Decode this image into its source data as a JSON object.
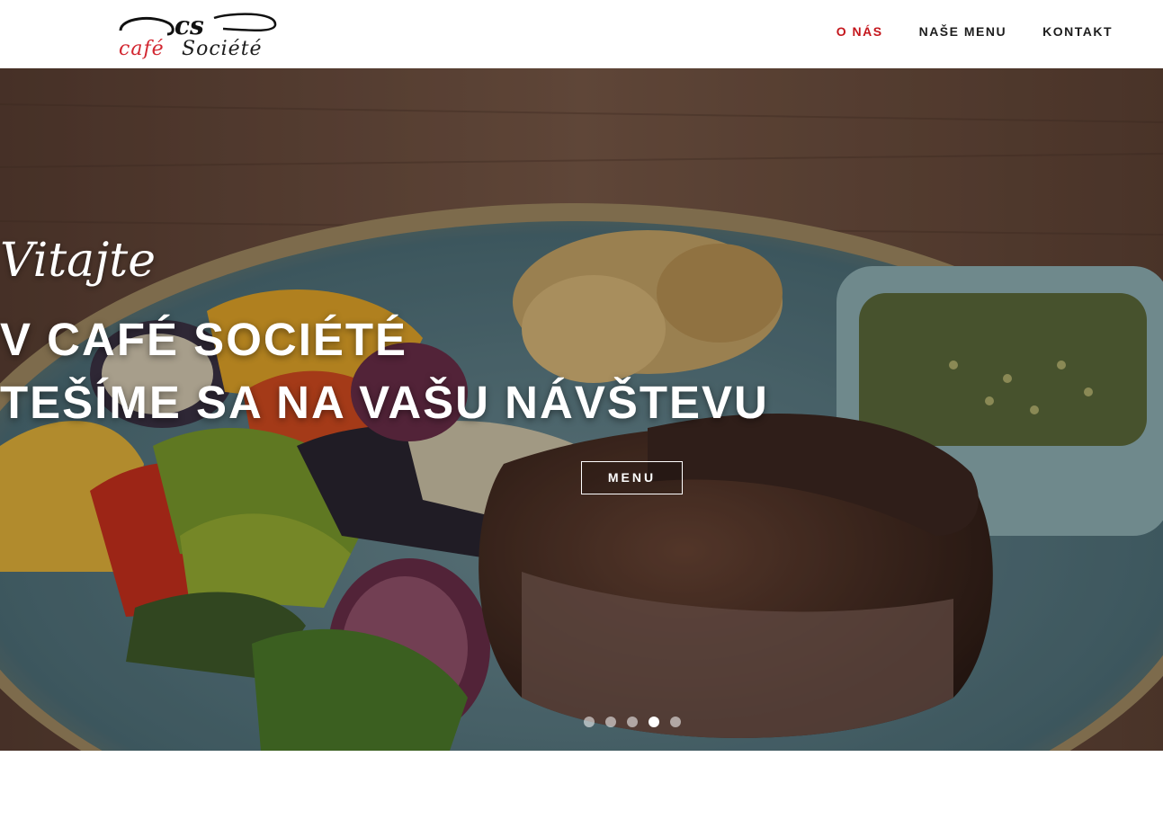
{
  "brand": {
    "monogram": "cs",
    "word1": "café",
    "word2": "Société",
    "accent_color": "#d22630"
  },
  "nav": {
    "items": [
      {
        "label": "O NÁS",
        "active": true
      },
      {
        "label": "NAŠE MENU",
        "active": false
      },
      {
        "label": "KONTAKT",
        "active": false
      }
    ]
  },
  "hero": {
    "welcome": "Vitajte",
    "line1": "V CAFÉ SOCIÉTÉ",
    "line2": "TEŠÍME SA NA VAŠU NÁVŠTEVU",
    "button_label": "MENU",
    "slides_total": 5,
    "active_slide": 4
  },
  "colors": {
    "nav_active": "#c4161c",
    "nav_text": "#1d1d1d"
  }
}
